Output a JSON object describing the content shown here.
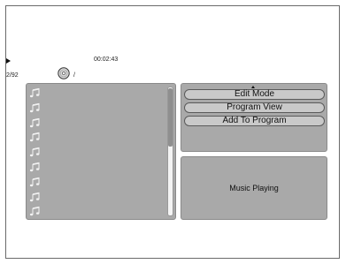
{
  "player": {
    "time": "00:02:43",
    "track_count": "2/92",
    "path": "/"
  },
  "file_list": {
    "icon": "music-note-icon",
    "row_count": 9
  },
  "menu": {
    "items": [
      "Edit Mode",
      "Program View",
      "Add To Program"
    ]
  },
  "status": {
    "text": "Music Playing"
  }
}
